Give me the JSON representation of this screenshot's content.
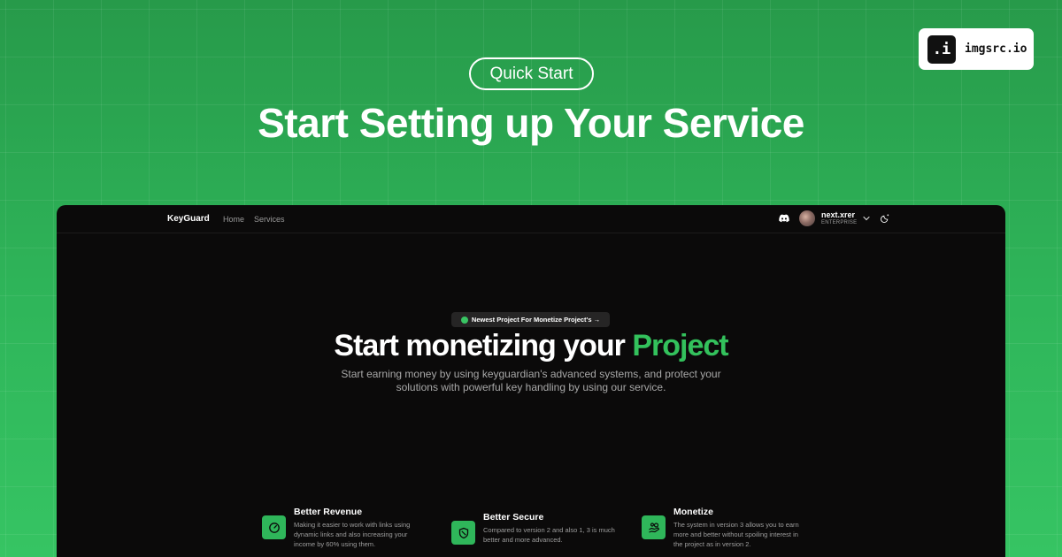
{
  "banner": {
    "badge": "Quick Start",
    "title": "Start Setting up Your Service",
    "logo_icon": ".i",
    "logo_text": "imgsrc.io"
  },
  "nav": {
    "brand": "KeyGuard",
    "links": [
      "Home",
      "Services"
    ],
    "user_name": "next.xrer",
    "user_plan": "ENTERPRISE",
    "icons": [
      "discord-icon",
      "chevron-down-icon",
      "theme-toggle-icon"
    ]
  },
  "hero": {
    "pill": "Newest Project For Monetize Project's →",
    "title_main": "Start monetizing your ",
    "title_accent": "Project",
    "subtitle": "Start earning money by using keyguardian's advanced systems, and protect your solutions with powerful key handling by using our service."
  },
  "features": [
    {
      "title": "Better Revenue",
      "description": "Making it easier to work with links using dynamic links and also increasing your income by 60% using them.",
      "icon": "gauge-icon"
    },
    {
      "title": "Better Secure",
      "description": "Compared to version 2 and also 1, 3 is much better and more advanced.",
      "icon": "shield-icon"
    },
    {
      "title": "Monetize",
      "description": "The system in version 3 allows you to earn more and better without spoiling interest in the project as in version 2.",
      "icon": "hand-coins-icon"
    }
  ],
  "colors": {
    "accent": "#33c15c",
    "window_bg": "#0b0a0a",
    "banner_bg_top": "#279a4a",
    "banner_bg_bottom": "#36c463"
  }
}
